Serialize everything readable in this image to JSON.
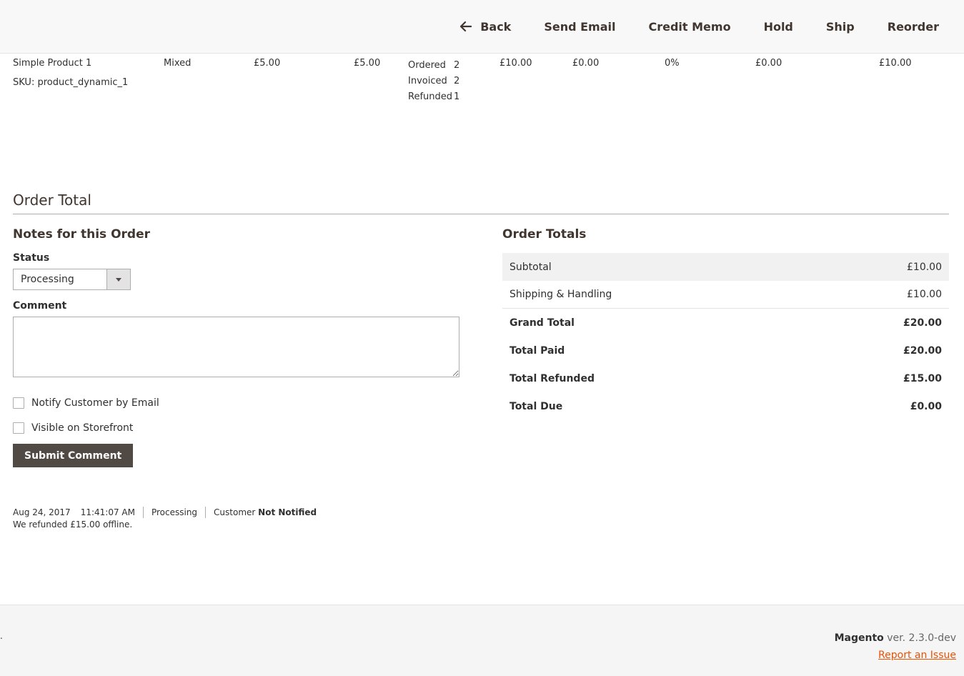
{
  "toolbar": {
    "back": "Back",
    "send_email": "Send Email",
    "credit_memo": "Credit Memo",
    "hold": "Hold",
    "ship": "Ship",
    "reorder": "Reorder"
  },
  "item": {
    "name": "Simple Product 1",
    "sku": "SKU: product_dynamic_1",
    "status": "Mixed",
    "original_price": "£5.00",
    "price": "£5.00",
    "qty_ordered_label": "Ordered",
    "qty_ordered": "2",
    "qty_invoiced_label": "Invoiced",
    "qty_invoiced": "2",
    "qty_refunded_label": "Refunded",
    "qty_refunded": "1",
    "subtotal": "£10.00",
    "tax_amount": "£0.00",
    "tax_percent": "0%",
    "discount": "£0.00",
    "row_total": "£10.00"
  },
  "section": {
    "title": "Order Total"
  },
  "notes": {
    "title": "Notes for this Order",
    "status_label": "Status",
    "status_value": "Processing",
    "comment_label": "Comment",
    "comment_value": "",
    "notify_label": "Notify Customer by Email",
    "visible_label": "Visible on Storefront",
    "submit_label": "Submit Comment"
  },
  "history": {
    "date": "Aug 24, 2017",
    "time": "11:41:07 AM",
    "status": "Processing",
    "customer_prefix": "Customer",
    "customer_state": "Not Notified",
    "note": "We refunded £15.00 offline."
  },
  "totals": {
    "title": "Order Totals",
    "rows": [
      {
        "label": "Subtotal",
        "value": "£10.00"
      },
      {
        "label": "Shipping & Handling",
        "value": "£10.00"
      },
      {
        "label": "Grand Total",
        "value": "£20.00"
      },
      {
        "label": "Total Paid",
        "value": "£20.00"
      },
      {
        "label": "Total Refunded",
        "value": "£15.00"
      },
      {
        "label": "Total Due",
        "value": "£0.00"
      }
    ]
  },
  "footer": {
    "dot": ".",
    "brand": "Magento",
    "version": "ver. 2.3.0-dev",
    "report": "Report an Issue"
  },
  "colors": {
    "button_dark": "#514943",
    "link_orange": "#eb5202"
  }
}
